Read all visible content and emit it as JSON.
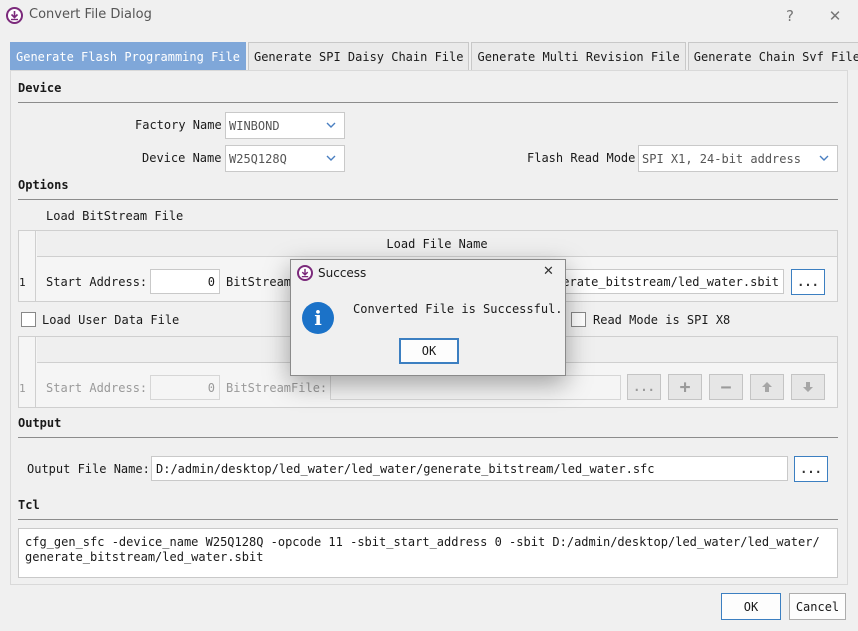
{
  "window": {
    "title": "Convert File Dialog",
    "help_glyph": "?",
    "close_glyph": "✕"
  },
  "tabs": [
    {
      "label": "Generate Flash Programming File",
      "active": true
    },
    {
      "label": "Generate SPI Daisy Chain File"
    },
    {
      "label": "Generate Multi Revision File"
    },
    {
      "label": "Generate Chain Svf File"
    }
  ],
  "device": {
    "section_title": "Device",
    "factory_name_label": "Factory Name",
    "factory_name_value": "WINBOND",
    "device_name_label": "Device Name",
    "device_name_value": "W25Q128Q",
    "flash_read_mode_label": "Flash Read Mode",
    "flash_read_mode_value": "SPI X1, 24-bit address"
  },
  "options": {
    "section_title": "Options",
    "load_bitstream_label": "Load BitStream File",
    "table_header": "Load File Name",
    "row_number": "1",
    "start_address_label": "Start Address:",
    "start_address_value": "0",
    "bitstream_label": "BitStream",
    "bitstream_path": "nerate_bitstream/led_water.sbit",
    "browse_label": "...",
    "load_user_data_label": "Load User Data File",
    "read_mode_x8_label": "Read Mode is SPI X8",
    "user_row_number": "1",
    "user_start_address_label": "Start Address:",
    "user_start_address_value": "0",
    "user_bitstream_label": "BitStreamFile:",
    "user_bitstream_path": "",
    "user_browse_label": "...",
    "add_glyph": "+",
    "remove_glyph": "−"
  },
  "output": {
    "section_title": "Output",
    "file_name_label": "Output File Name:",
    "file_name_value": "D:/admin/desktop/led_water/led_water/generate_bitstream/led_water.sfc",
    "browse_label": "..."
  },
  "tcl": {
    "section_title": "Tcl",
    "line1": "cfg_gen_sfc -device_name W25Q128Q -opcode 11 -sbit_start_address 0 -sbit D:/admin/desktop/led_water/led_water/",
    "line2": "generate_bitstream/led_water.sbit"
  },
  "footer": {
    "ok_label": "OK",
    "cancel_label": "Cancel"
  },
  "modal": {
    "title": "Success",
    "message": "Converted File is Successful.",
    "ok_label": "OK",
    "info_glyph": "i",
    "close_glyph": "✕"
  },
  "colors": {
    "tab_active": "#7fa7d9",
    "accent_border": "#3c7fc1",
    "info_icon": "#1b72c8",
    "app_icon": "#7b2a7b"
  }
}
